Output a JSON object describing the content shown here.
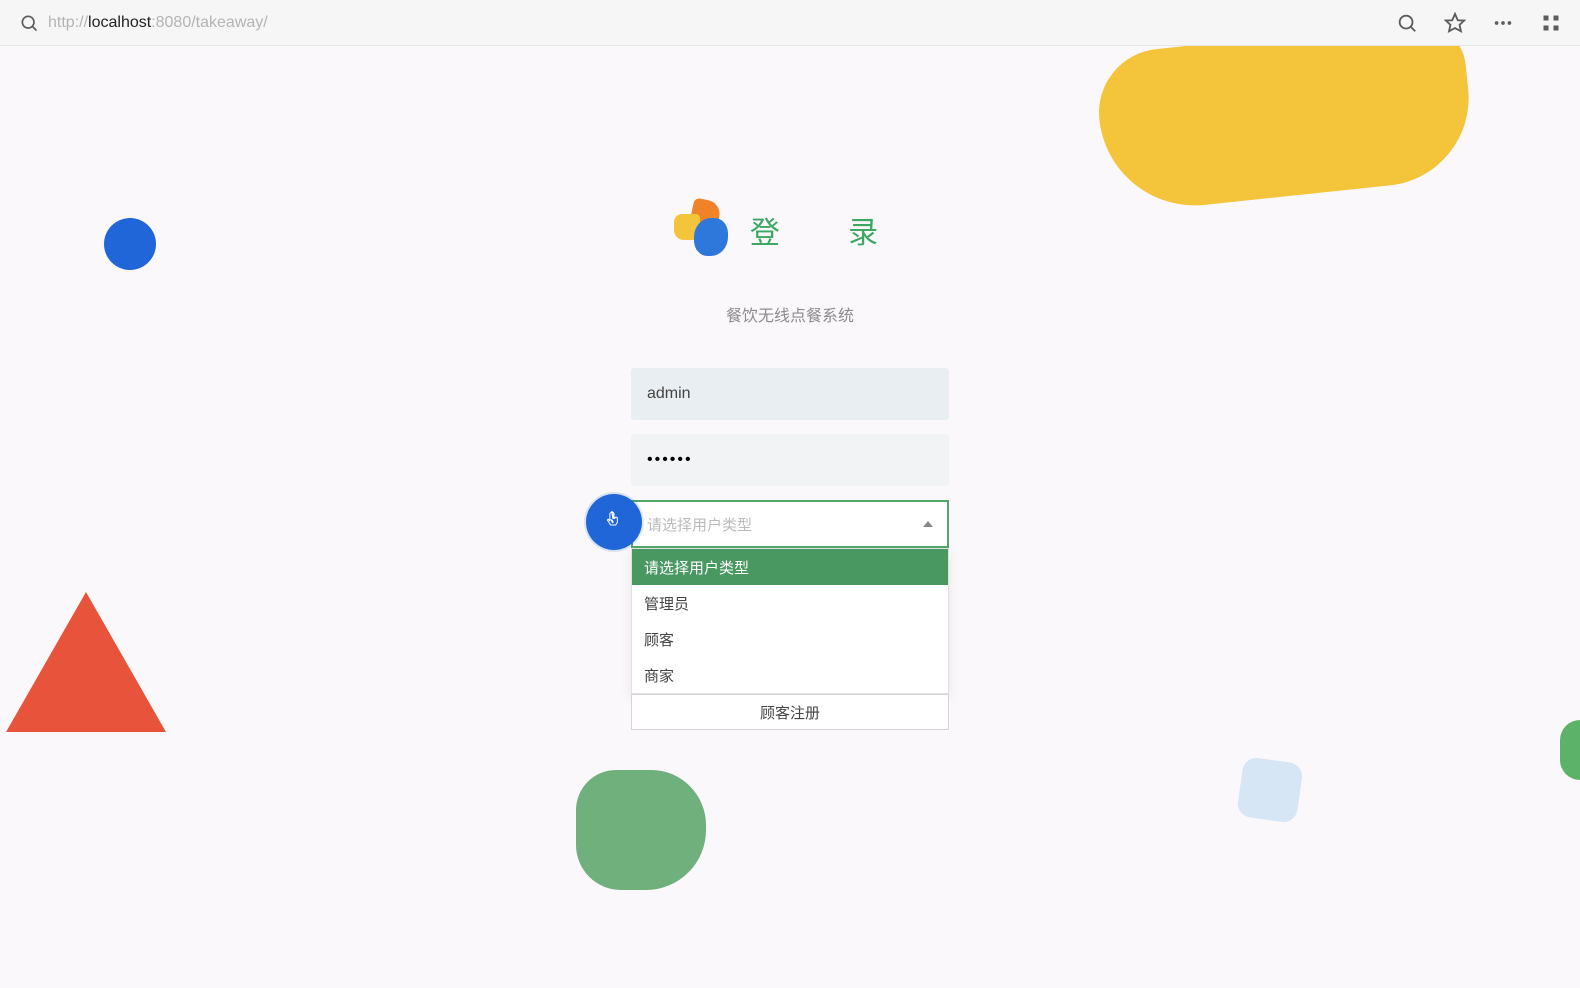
{
  "browser": {
    "url_parts": {
      "prefix": "http://",
      "host": "localhost",
      "port": ":8080",
      "path": "/takeaway/"
    }
  },
  "login": {
    "title": "登 录",
    "subtitle": "餐饮无线点餐系统",
    "username_value": "admin",
    "password_value": "••••••",
    "select_placeholder": "请选择用户类型",
    "options": [
      {
        "label": "请选择用户类型"
      },
      {
        "label": "管理员"
      },
      {
        "label": "顾客"
      },
      {
        "label": "商家"
      }
    ],
    "register_label": "顾客注册"
  }
}
